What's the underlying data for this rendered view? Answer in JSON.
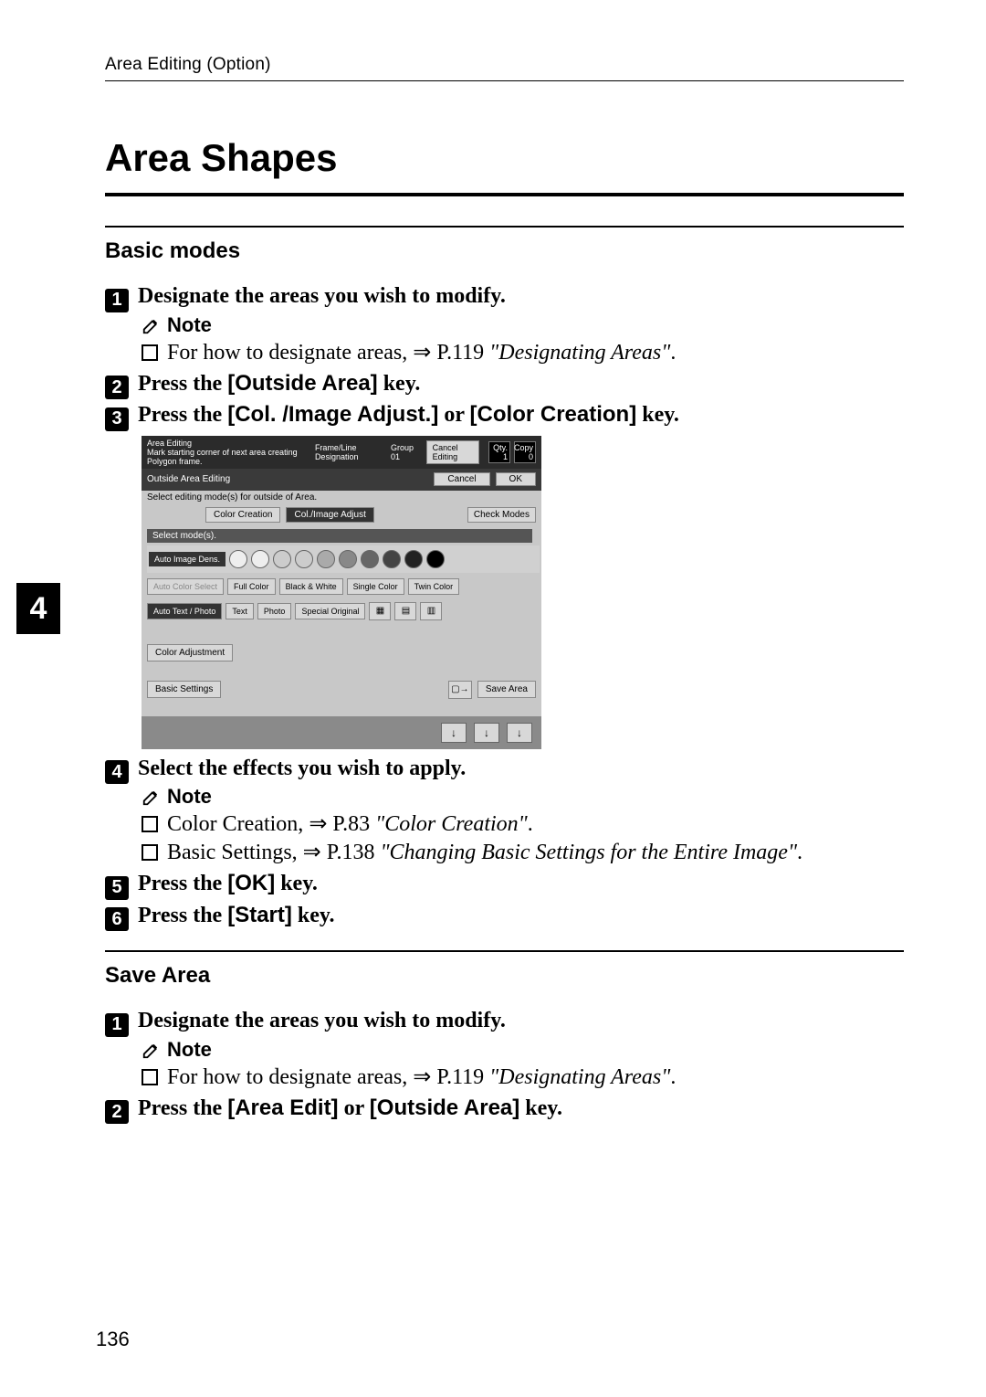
{
  "running_head": "Area Editing (Option)",
  "section_title": "Area Shapes",
  "side_tab": "4",
  "page_number": "136",
  "sections": {
    "basic": {
      "heading": "Basic modes",
      "steps": {
        "s1": {
          "num": "1",
          "text_a": "Designate the areas you wish to modify."
        },
        "s1_note_label": "Note",
        "s1_note_line_a": "For how to designate areas, ",
        "s1_note_line_b": " P.119 ",
        "s1_note_line_c": "\"Designating Areas\"",
        "s1_note_line_d": ".",
        "s2": {
          "num": "2",
          "pre": "Press the ",
          "key": "[Outside Area]",
          "post": " key."
        },
        "s3": {
          "num": "3",
          "pre": "Press the ",
          "key1": "[Col. /Image Adjust.]",
          "mid": " or ",
          "key2": "[Color Creation]",
          "post": " key."
        },
        "s4": {
          "num": "4",
          "text": "Select the effects you wish to apply."
        },
        "s4_note_label": "Note",
        "s4_note1_a": "Color Creation, ",
        "s4_note1_b": " P.83 ",
        "s4_note1_c": "\"Color Creation\"",
        "s4_note1_d": ".",
        "s4_note2_a": "Basic Settings, ",
        "s4_note2_b": " P.138 ",
        "s4_note2_c": "\"Changing Basic Settings for the Entire Image\"",
        "s4_note2_d": ".",
        "s5": {
          "num": "5",
          "pre": "Press the ",
          "key": "[OK]",
          "post": " key."
        },
        "s6": {
          "num": "6",
          "pre": "Press the ",
          "key": "[Start]",
          "post": " key."
        }
      }
    },
    "save": {
      "heading": "Save Area",
      "steps": {
        "s1": {
          "num": "1",
          "text_a": "Designate the areas you wish to modify."
        },
        "s1_note_label": "Note",
        "s1_note_line_a": "For how to designate areas, ",
        "s1_note_line_b": " P.119 ",
        "s1_note_line_c": "\"Designating Areas\"",
        "s1_note_line_d": ".",
        "s2": {
          "num": "2",
          "pre": "Press the ",
          "key1": "[Area Edit]",
          "mid": " or ",
          "key2": "[Outside Area]",
          "post": " key."
        }
      }
    }
  },
  "screenshot": {
    "titlebar": {
      "area_editing": "Area Editing",
      "frame_line": "Frame/Line Designation",
      "group": "Group 01",
      "hint": "Mark starting corner of next area creating Polygon frame.",
      "cancel_editing": "Cancel Editing",
      "counter1_top": "Qty.",
      "counter1_bot": "1",
      "counter2_top": "Copy",
      "counter2_bot": "0"
    },
    "row2": {
      "label": "Outside Area Editing",
      "cancel": "Cancel",
      "ok": "OK"
    },
    "instr": "Select editing mode(s) for outside of Area.",
    "modebtns": {
      "color_creation": "Color Creation",
      "col_image_adjust": "Col./Image Adjust"
    },
    "check_modes": "Check Modes",
    "select_modes": "Select mode(s).",
    "color_row_tag": "Auto Image Dens.",
    "row_a": {
      "b1": "Auto Color Select",
      "b2": "Full Color",
      "b3": "Black & White",
      "b4": "Single Color",
      "b5": "Twin Color"
    },
    "row_b": {
      "b1": "Auto Text / Photo",
      "b2": "Text",
      "b3": "Photo",
      "b4": "Special Original"
    },
    "color_adjustment": "Color Adjustment",
    "bottom": {
      "basic_settings": "Basic Settings",
      "save_area": "Save Area"
    }
  }
}
